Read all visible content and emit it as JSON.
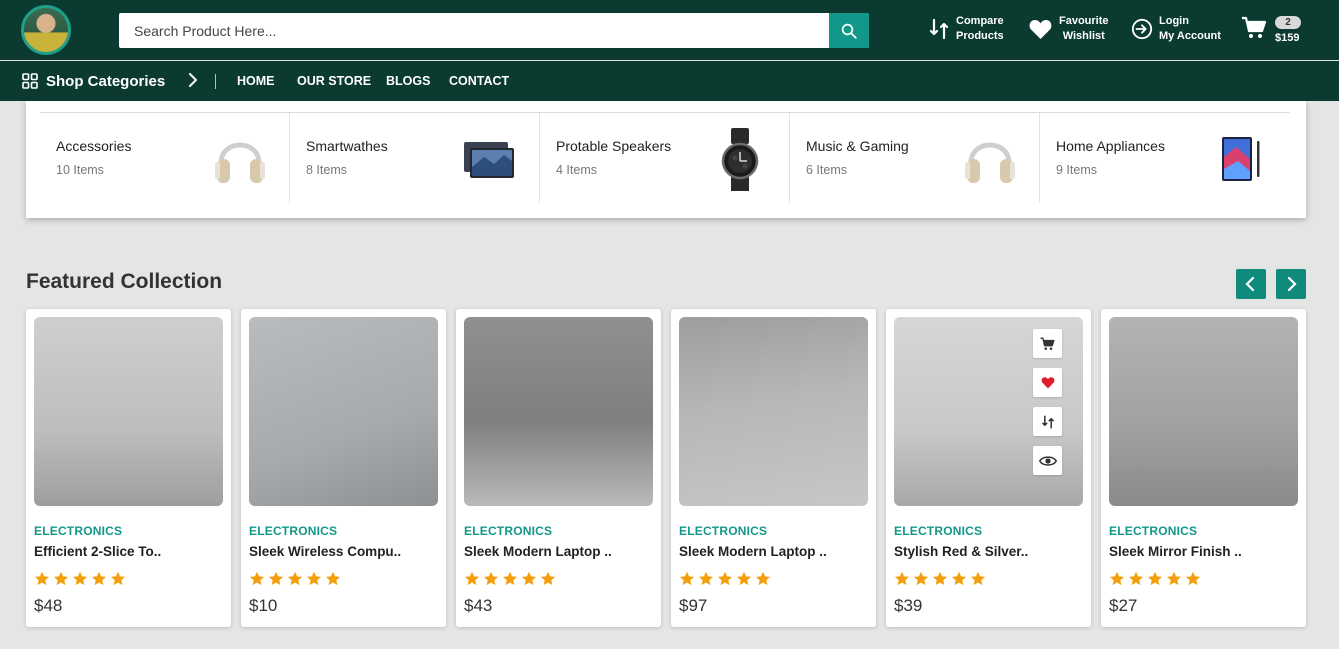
{
  "header": {
    "search_placeholder": "Search Product Here...",
    "compare": {
      "line1": "Compare",
      "line2": "Products"
    },
    "wishlist": {
      "line1": "Favourite",
      "line2": "Wishlist"
    },
    "account": {
      "line1": "Login",
      "line2": "My Account"
    },
    "cart": {
      "count": "2",
      "total": "$159"
    }
  },
  "nav": {
    "categories_label": "Shop Categories",
    "items": [
      "HOME",
      "OUR STORE",
      "BLOGS",
      "CONTACT"
    ]
  },
  "categories": [
    {
      "name": "Accessories",
      "count": "10 Items",
      "icon": "headphones-icon"
    },
    {
      "name": "Smartwathes",
      "count": "8 Items",
      "icon": "tablet-icon"
    },
    {
      "name": "Protable Speakers",
      "count": "4 Items",
      "icon": "watch-icon"
    },
    {
      "name": "Music & Gaming",
      "count": "6 Items",
      "icon": "headphones-icon"
    },
    {
      "name": "Home Appliances",
      "count": "9 Items",
      "icon": "tablet-icon"
    }
  ],
  "featured": {
    "title": "Featured Collection",
    "products": [
      {
        "category": "ELECTRONICS",
        "name": "Efficient 2-Slice To..",
        "price": "$48",
        "rating": 5
      },
      {
        "category": "ELECTRONICS",
        "name": "Sleek Wireless Compu..",
        "price": "$10",
        "rating": 5
      },
      {
        "category": "ELECTRONICS",
        "name": "Sleek Modern Laptop ..",
        "price": "$43",
        "rating": 5
      },
      {
        "category": "ELECTRONICS",
        "name": "Sleek Modern Laptop ..",
        "price": "$97",
        "rating": 5
      },
      {
        "category": "ELECTRONICS",
        "name": "Stylish Red & Silver..",
        "price": "$39",
        "rating": 5
      },
      {
        "category": "ELECTRONICS",
        "name": "Sleek Mirror Finish ..",
        "price": "$27",
        "rating": 5
      }
    ]
  },
  "colors": {
    "header_bg": "#0b3b30",
    "accent": "#12988a",
    "star": "#f59e0b",
    "wishlist_heart": "#e11d2a"
  }
}
